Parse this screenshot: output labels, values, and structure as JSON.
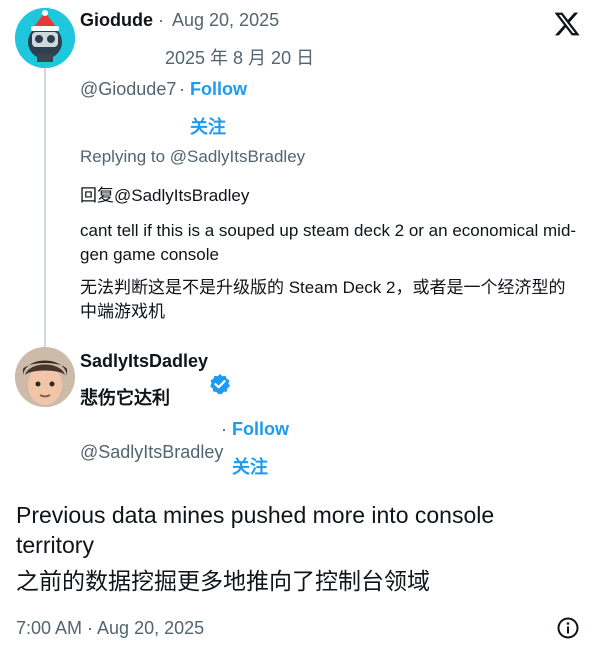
{
  "reply": {
    "author_name": "Giodude",
    "separator": "·",
    "date": "Aug 20, 2025",
    "date_translated": "2025 年 8 月 20 日",
    "handle": "@Giodude7",
    "follow_separator": "·",
    "follow_label": "Follow",
    "follow_translated": "关注",
    "replying_to": "Replying to @SadlyItsBradley",
    "replying_to_translated": "回复@SadlyItsBradley",
    "text": "cant tell if this is a souped up steam deck 2 or an economical mid-gen game console",
    "text_translated": "无法判断这是不是升级版的 Steam Deck 2，或者是一个经济型的中端游戏机"
  },
  "main": {
    "author_name": "SadlyItsDadley",
    "author_name_translated": "悲伤它达利",
    "handle": "@SadlyItsBradley",
    "follow_separator": "·",
    "follow_label": "Follow",
    "follow_translated": "关注",
    "text": "Previous data mines pushed more into console territory",
    "text_translated": "之前的数据挖掘更多地推向了控制台领域",
    "timestamp": "7:00 AM · Aug 20, 2025"
  },
  "colors": {
    "accent": "#1d9bf0",
    "secondary_text": "#536471",
    "primary_text": "#0f1419",
    "thread_line": "#cfd9de"
  },
  "icons": {
    "logo": "x-logo-icon",
    "verified": "verified-badge-icon",
    "info": "info-icon"
  }
}
